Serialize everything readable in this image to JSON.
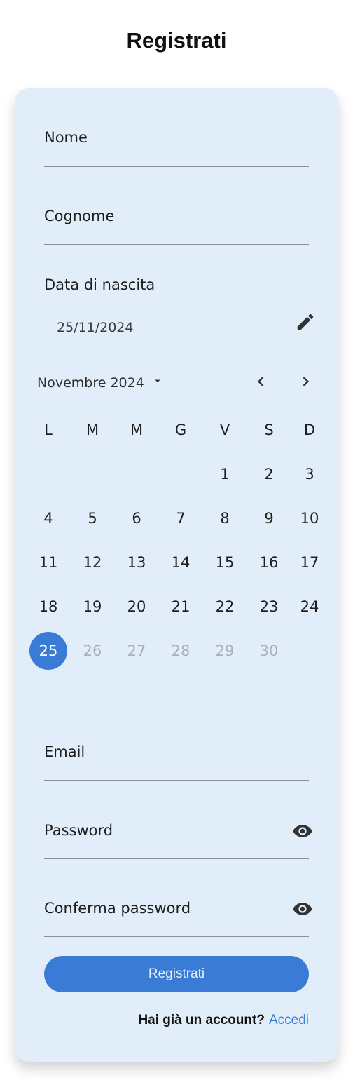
{
  "header": {
    "title": "Registrati"
  },
  "form": {
    "first_name_label": "Nome",
    "last_name_label": "Cognome",
    "dob_label": "Data di nascita",
    "dob_value": "25/11/2024",
    "email_label": "Email",
    "password_label": "Password",
    "confirm_password_label": "Conferma password",
    "submit_label": "Registrati"
  },
  "calendar": {
    "month_label": "Novembre 2024",
    "weekdays": [
      "L",
      "M",
      "M",
      "G",
      "V",
      "S",
      "D"
    ],
    "weeks": [
      [
        "",
        "",
        "",
        "",
        "1",
        "2",
        "3"
      ],
      [
        "4",
        "5",
        "6",
        "7",
        "8",
        "9",
        "10"
      ],
      [
        "11",
        "12",
        "13",
        "14",
        "15",
        "16",
        "17"
      ],
      [
        "18",
        "19",
        "20",
        "21",
        "22",
        "23",
        "24"
      ],
      [
        "25",
        "26",
        "27",
        "28",
        "29",
        "30",
        ""
      ]
    ],
    "selected_day": "25",
    "disabled_after": 25
  },
  "footer": {
    "question": "Hai già un account?",
    "link": "Accedi"
  },
  "colors": {
    "accent": "#3a7bd5",
    "card_background": "#e1eefa"
  },
  "icons": {
    "edit": "pencil-icon",
    "dropdown": "caret-down-icon",
    "prev": "chevron-left-icon",
    "next": "chevron-right-icon",
    "password_visibility": "eye-icon"
  }
}
